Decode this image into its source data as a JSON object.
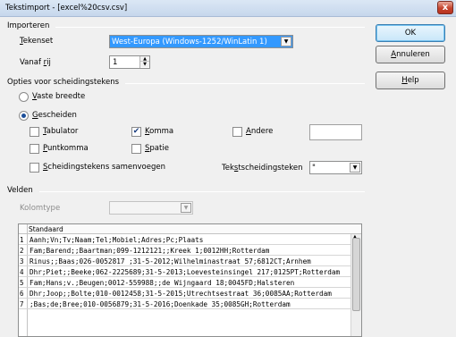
{
  "window": {
    "title": "Tekstimport - [excel%20csv.csv]",
    "close_glyph": "x"
  },
  "import": {
    "group_label": "Importeren",
    "charset_label_prefix": "",
    "charset_label_u": "T",
    "charset_label_rest": "ekenset",
    "charset_value": "West-Europa (Windows-1252/WinLatin 1)",
    "from_row_label_prefix": "Vanaf ",
    "from_row_label_u": "r",
    "from_row_label_rest": "ij",
    "from_row_value": "1"
  },
  "separators": {
    "group_label": "Opties voor scheidingstekens",
    "fixed_width_u": "V",
    "fixed_width_rest": "aste breedte",
    "separated_u": "G",
    "separated_rest": "escheiden",
    "tab_u": "T",
    "tab_rest": "abulator",
    "comma_u": "K",
    "comma_rest": "omma",
    "other_u": "A",
    "other_rest": "ndere",
    "semicolon_u": "P",
    "semicolon_rest": "untkomma",
    "space_u": "S",
    "space_rest": "patie",
    "merge_u": "S",
    "merge_rest": "cheidingstekens samenvoegen",
    "text_delim_prefix": "Tek",
    "text_delim_u": "s",
    "text_delim_rest": "tscheidingsteken",
    "text_delim_value": "\"",
    "checkmark": "✔"
  },
  "fields": {
    "group_label": "Velden",
    "column_type_label": "Kolomtype",
    "column_header": "Standaard",
    "rows": [
      {
        "num": "1",
        "text": "Aanh;Vn;Tv;Naam;Tel;Mobiel;Adres;Pc;Plaats"
      },
      {
        "num": "2",
        "text": "Fam;Barend;;Baartman;099-1212121;;Kreek 1;0012HH;Rotterdam"
      },
      {
        "num": "3",
        "text": "Rinus;;Baas;026-0052817 ;31-5-2012;Wilhelminastraat 57;6812CT;Arnhem"
      },
      {
        "num": "4",
        "text": "Dhr;Piet;;Beeke;062-2225689;31-5-2013;Loevesteinsingel 217;0125PT;Rotterdam"
      },
      {
        "num": "5",
        "text": "Fam;Hans;v.;Beugen;0012-559988;;de Wijngaard 18;0045FD;Halsteren"
      },
      {
        "num": "6",
        "text": "Dhr;Joop;;Bolte;010-0012458;31-5-2015;Utrechtsestraat 36;0085AA;Rotterdam"
      },
      {
        "num": "7",
        "text": ";Bas;de;Bree;010-0056879;31-5-2016;Doenkade 35;0085GH;Rotterdam"
      }
    ]
  },
  "buttons": {
    "ok": "OK",
    "cancel_u": "A",
    "cancel_rest": "nnuleren",
    "help_u": "H",
    "help_rest": "elp"
  },
  "colors": {
    "selected_combo": "#3399ff",
    "title_gradient_top": "#dbe7f5"
  }
}
